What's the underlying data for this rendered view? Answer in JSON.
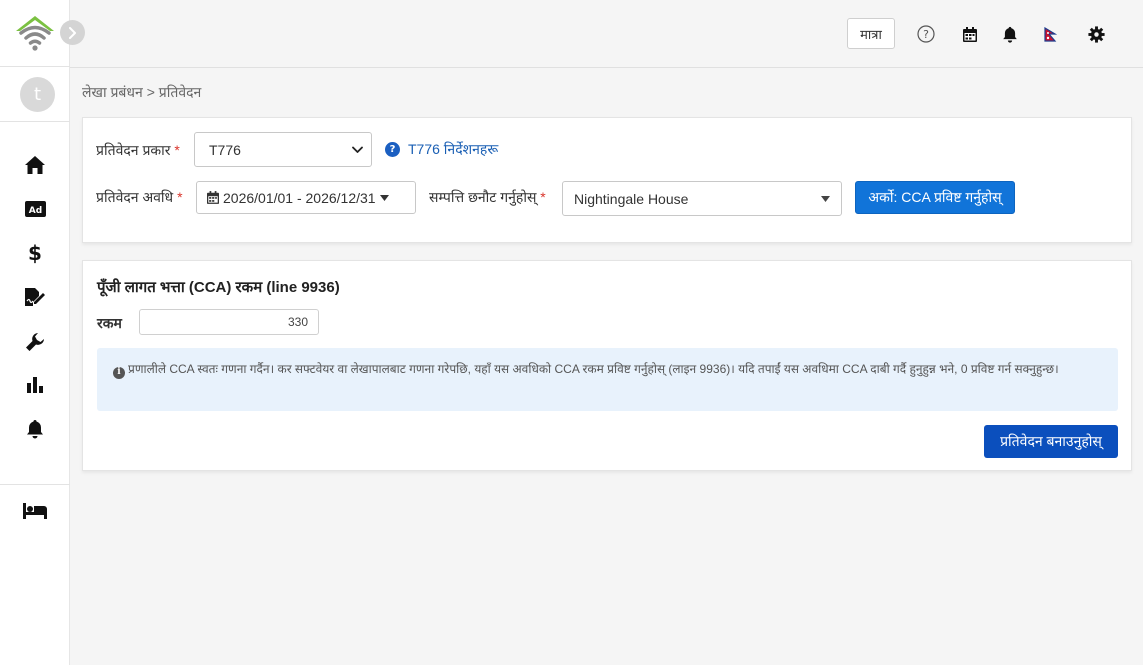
{
  "topbar": {
    "unit_button_label": "मात्रा",
    "icons": [
      "help-icon",
      "calendar-icon",
      "bell-icon",
      "flag-icon",
      "gear-icon"
    ]
  },
  "sidebar": {
    "avatar_letter": "t",
    "items": [
      {
        "name": "home",
        "icon": "home-icon"
      },
      {
        "name": "ads",
        "icon": "ad-icon"
      },
      {
        "name": "finance",
        "icon": "dollar-icon"
      },
      {
        "name": "documents",
        "icon": "file-signature-icon"
      },
      {
        "name": "tools",
        "icon": "wrench-icon"
      },
      {
        "name": "reports",
        "icon": "bar-chart-icon"
      },
      {
        "name": "notifications",
        "icon": "bell-icon"
      },
      {
        "name": "bookings",
        "icon": "bed-icon"
      }
    ]
  },
  "breadcrumb": {
    "text": "लेखा प्रबंधन > प्रतिवेदन"
  },
  "filters": {
    "report_type_label": "प्रतिवेदन प्रकार",
    "report_type_value": "T776",
    "help_link_text": "T776 निर्देशनहरू",
    "period_label": "प्रतिवेदन अवधि",
    "period_value": "2026/01/01 - 2026/12/31",
    "property_label": "सम्पत्ति छनौट गर्नुहोस्",
    "property_value": "Nightingale House",
    "next_button_label": "अर्को: CCA प्रविष्ट गर्नुहोस्",
    "required_mark": "*"
  },
  "cca": {
    "title": "पूँजी लागत भत्ता (CCA) रकम  (line 9936)",
    "amount_label": "रकम",
    "amount_value": "330",
    "info_text": "प्रणालीले CCA स्वतः गणना गर्दैन। कर सफ्टवेयर वा लेखापालबाट गणना गरेपछि, यहाँ यस अवधिको CCA रकम प्रविष्ट गर्नुहोस् (लाइन 9936)। यदि तपाईं यस अवधिमा CCA दाबी गर्दै हुनुहुन्न भने, 0 प्रविष्ट गर्न सक्नुहुन्छ।",
    "info_icon_glyph": "i",
    "generate_button_label": "प्रतिवेदन बनाउनुहोस्"
  },
  "colors": {
    "primary": "#1174d9",
    "primary_dark": "#0b4fbd",
    "info_bg": "#e8f2fc",
    "logo_green": "#7bc142"
  }
}
